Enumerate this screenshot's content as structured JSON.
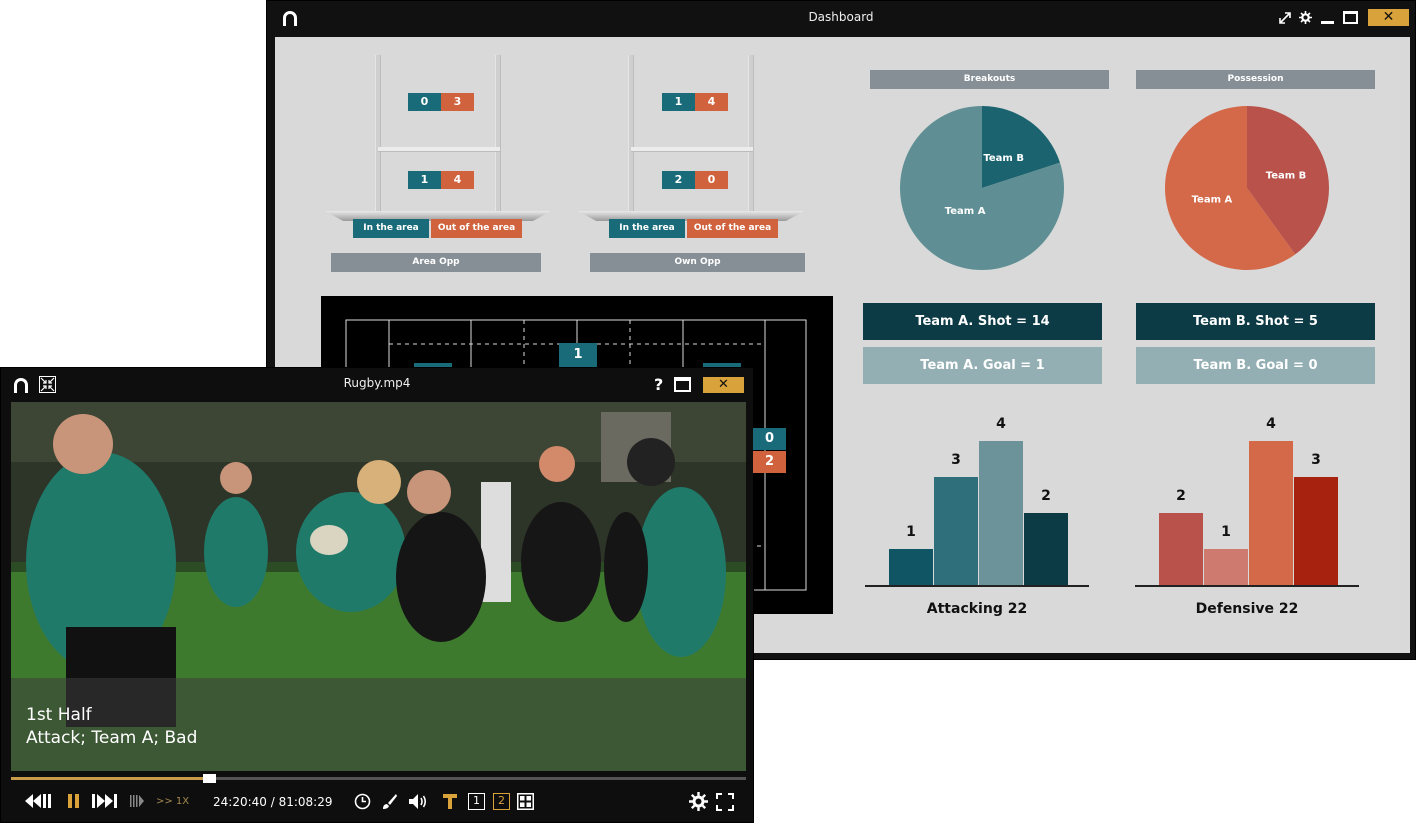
{
  "dashboard": {
    "title": "Dashboard",
    "area_opp": {
      "top": {
        "in": "0",
        "out": "3"
      },
      "bottom": {
        "in": "1",
        "out": "4"
      },
      "legend_in": "In the area",
      "legend_out": "Out of the area",
      "label": "Area Opp"
    },
    "own_opp": {
      "top": {
        "in": "1",
        "out": "4"
      },
      "bottom": {
        "in": "2",
        "out": "0"
      },
      "legend_in": "In the area",
      "legend_out": "Out of the area",
      "label": "Own Opp"
    },
    "field": {
      "cells": [
        "1",
        "0",
        "2"
      ]
    },
    "stats": {
      "team_a_shot": "Team A. Shot = 14",
      "team_a_goal": "Team A. Goal = 1",
      "team_b_shot": "Team B. Shot = 5",
      "team_b_goal": "Team B. Goal = 0"
    },
    "colors": {
      "teal": "#1a6b7a",
      "orange": "#d0623d",
      "accent": "#d9a23b"
    }
  },
  "chart_data": [
    {
      "type": "pie",
      "title": "Breakouts",
      "labels": [
        "Team A",
        "Team B"
      ],
      "values": [
        80,
        20
      ],
      "colors": [
        "#5f8f94",
        "#1c6370"
      ]
    },
    {
      "type": "pie",
      "title": "Possession",
      "labels": [
        "Team A",
        "Team B"
      ],
      "values": [
        60,
        40
      ],
      "colors": [
        "#d4694a",
        "#b8524a"
      ]
    },
    {
      "type": "bar",
      "title": "Attacking  22",
      "categories": [
        "",
        "",
        "",
        ""
      ],
      "values": [
        1,
        3,
        4,
        2
      ],
      "colors": [
        "#0f5563",
        "#2e6f7b",
        "#6b9399",
        "#0c3a45"
      ],
      "ylim": [
        0,
        4
      ]
    },
    {
      "type": "bar",
      "title": "Defensive 22",
      "categories": [
        "",
        "",
        "",
        ""
      ],
      "values": [
        2,
        1,
        4,
        3
      ],
      "colors": [
        "#b8524a",
        "#cf7a6f",
        "#d4694a",
        "#a8230f"
      ],
      "ylim": [
        0,
        4
      ]
    }
  ],
  "player": {
    "title": "Rugby.mp4",
    "caption_line1": "1st Half",
    "caption_line2": "Attack; Team A; Bad",
    "speed": ">> 1X",
    "timecode": "24:20:40 / 81:08:29",
    "progress": 0.27,
    "help": "?",
    "view_1": "1",
    "view_2": "2"
  }
}
